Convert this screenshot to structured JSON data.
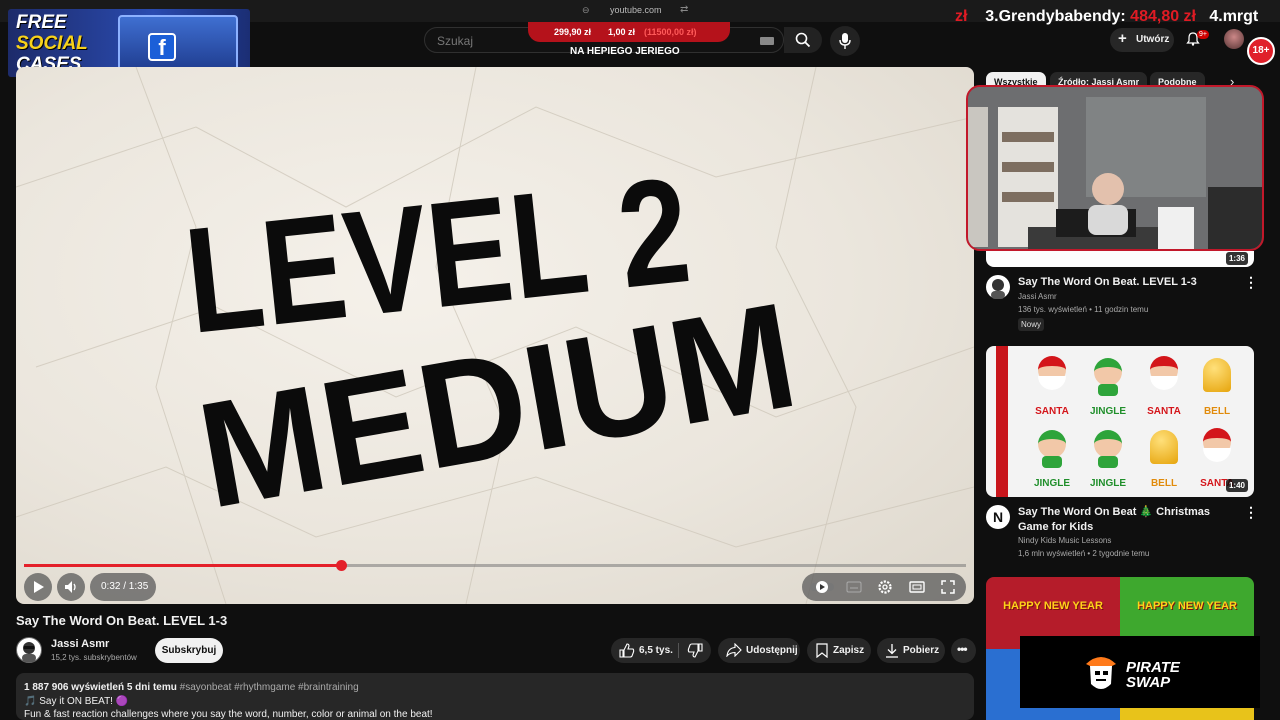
{
  "browser": {
    "url": "youtube.com"
  },
  "masthead": {
    "search_placeholder": "Szukaj",
    "create_label": "Utwórz",
    "notifications_count": "9+",
    "age_badge": "18+"
  },
  "stream_overlay": {
    "price_current": "299,90 zł",
    "price_bet": "1,00 zł",
    "price_struck": "(11500,00 zł)",
    "subtitle": "NA HEPIEGO JERIEGO",
    "ticker_prefix": "zł",
    "ticker_item": "3.Grendybabendy:",
    "ticker_amount": "484,80 zł",
    "ticker_next": "4.mrgt",
    "logo_line1": "FREE",
    "logo_line2": "SOCIAL",
    "logo_line3": "CASES",
    "sponsor_line1": "PIRATE",
    "sponsor_line2": "SWAP"
  },
  "player": {
    "frame_text_line1": "LEVEL 2",
    "frame_text_line2": "MEDIUM",
    "time": "0:32 / 1:35",
    "progress": 0.337
  },
  "video": {
    "title": "Say The Word On Beat. LEVEL 1-3",
    "channel": "Jassi Asmr",
    "subscribers": "15,2 tys. subskrybentów",
    "subscribe_label": "Subskrybuj",
    "likes": "6,5 tys.",
    "share_label": "Udostępnij",
    "save_label": "Zapisz",
    "download_label": "Pobierz"
  },
  "description": {
    "stats": "1 887 906 wyświetleń  5 dni temu",
    "hashtags": "#sayonbeat #rhythmgame #braintraining",
    "line2": "🎵 Say it ON BEAT! 🟣",
    "line3": "Fun & fast reaction challenges where you say the word, number, color or animal on the beat!"
  },
  "sidebar": {
    "chips": [
      "Wszystkie",
      "Źródło: Jassi Asmr",
      "Podobne"
    ],
    "videos": [
      {
        "title": "Say The Word On Beat. LEVEL 1-3",
        "channel": "Jassi Asmr",
        "meta": "136 tys. wyświetleń • 11 godzin temu",
        "badge": "Nowy",
        "duration": "1:36"
      },
      {
        "title": "Say The Word On Beat 🎄 Christmas Game for Kids",
        "channel": "Nindy Kids Music Lessons",
        "meta": "1,6 mln wyświetleń • 2 tygodnie temu",
        "duration": "1:40",
        "avatar_letter": "N",
        "thumb_labels": [
          "SANTA",
          "JINGLE",
          "SANTA",
          "BELL",
          "JINGLE",
          "JINGLE",
          "BELL",
          "SANTA"
        ]
      },
      {
        "thumb_labels": [
          "HAPPY NEW YEAR",
          "HAPPY NEW YEAR"
        ]
      }
    ]
  },
  "colors": {
    "accent": "#e4202a",
    "background": "#0f0f0f",
    "chip_active": "#f1f1f1"
  }
}
